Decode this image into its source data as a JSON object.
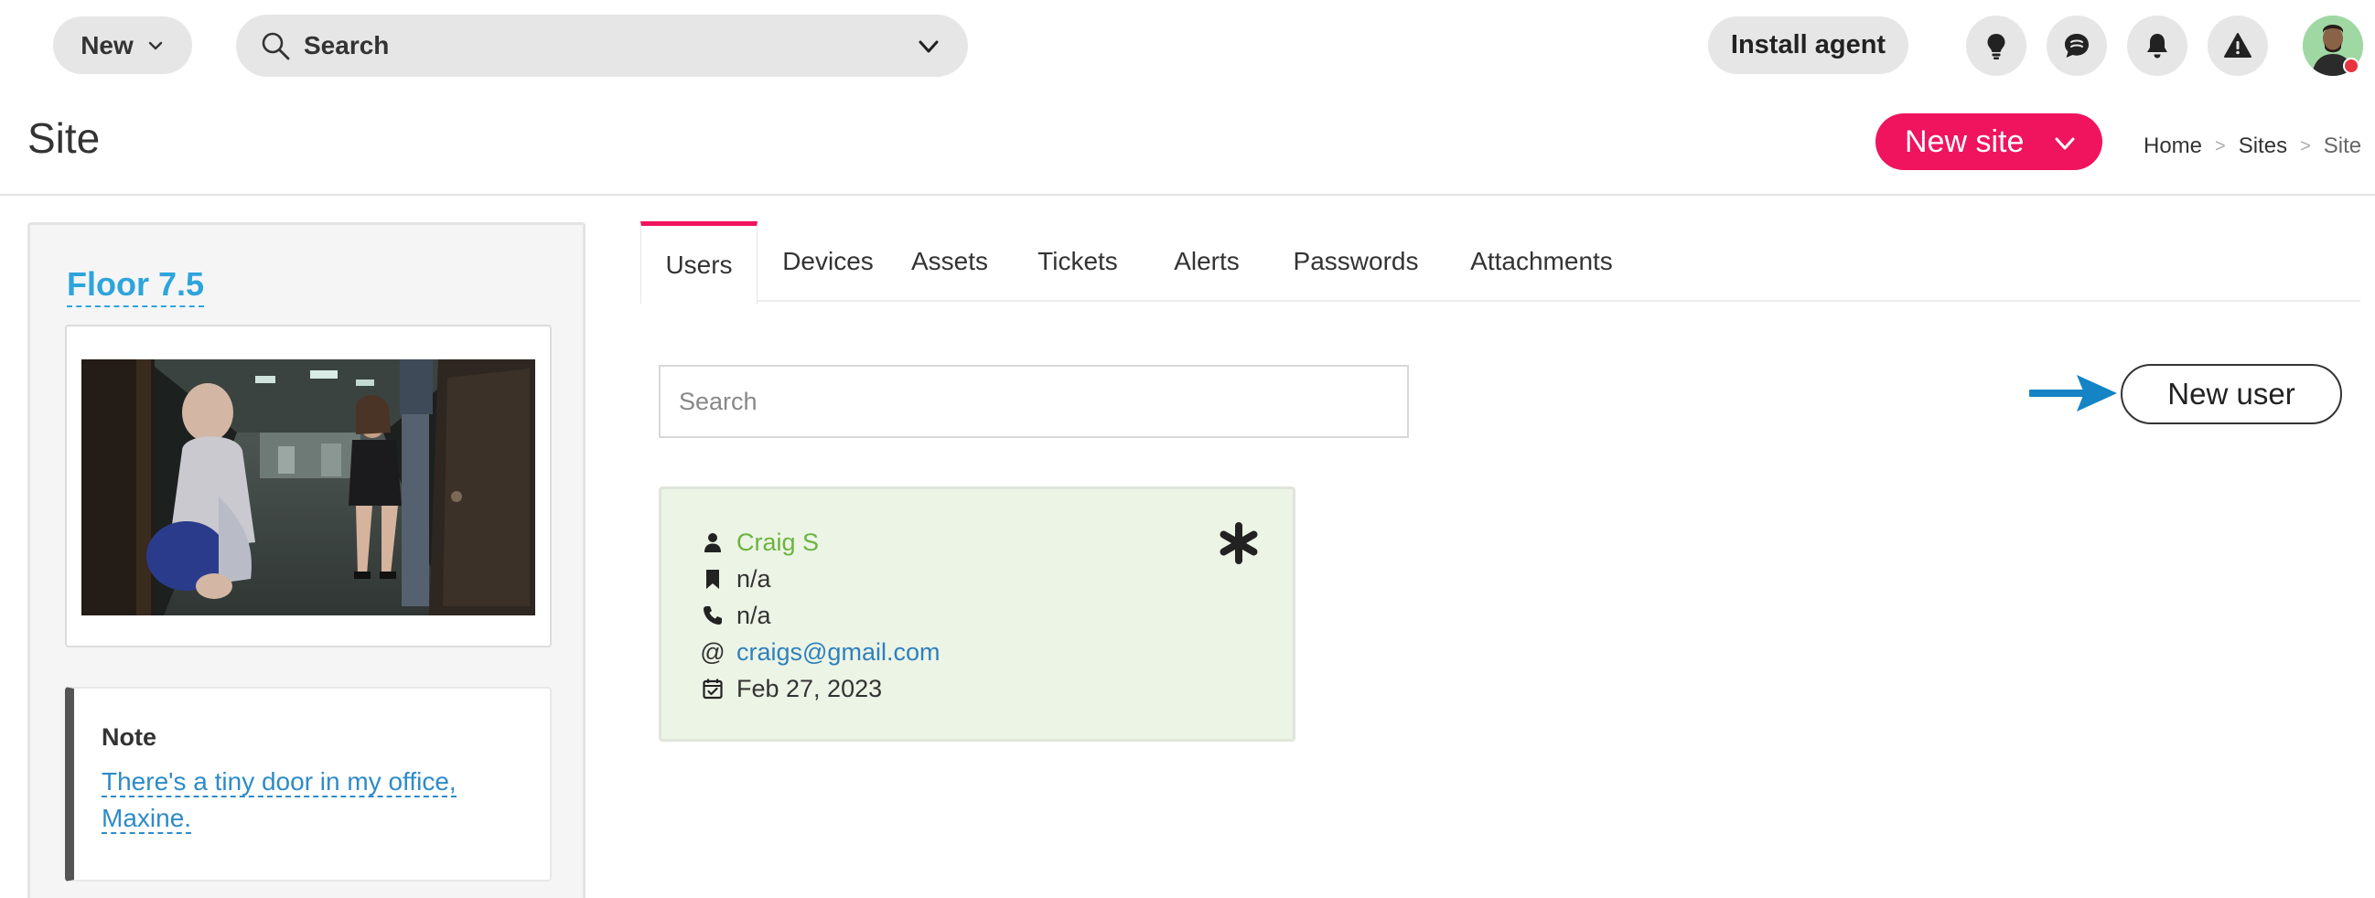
{
  "topbar": {
    "new_label": "New",
    "search_label": "Search",
    "install_label": "Install agent",
    "icons": [
      "lightbulb-icon",
      "chat-icon",
      "bell-icon",
      "warning-icon"
    ]
  },
  "header": {
    "title": "Site",
    "new_site_label": "New site",
    "breadcrumb": [
      "Home",
      "Sites",
      "Site"
    ],
    "breadcrumb_sep": ">"
  },
  "site": {
    "name": "Floor 7.5",
    "note_label": "Note",
    "note_text": "There's a tiny door in my office, Maxine."
  },
  "tabs": [
    {
      "label": "Users",
      "active": true
    },
    {
      "label": "Devices",
      "active": false
    },
    {
      "label": "Assets",
      "active": false
    },
    {
      "label": "Tickets",
      "active": false
    },
    {
      "label": "Alerts",
      "active": false
    },
    {
      "label": "Passwords",
      "active": false
    },
    {
      "label": "Attachments",
      "active": false
    }
  ],
  "users": {
    "search_placeholder": "Search",
    "new_user_label": "New user",
    "list": [
      {
        "name": "Craig S",
        "title": "n/a",
        "phone": "n/a",
        "email": "craigs@gmail.com",
        "date": "Feb 27, 2023"
      }
    ]
  },
  "colors": {
    "accent": "#f0135e",
    "link": "#2ea4dc",
    "user_name": "#6db33f",
    "card_bg": "#ecf4e6",
    "arrow": "#1584c5"
  }
}
